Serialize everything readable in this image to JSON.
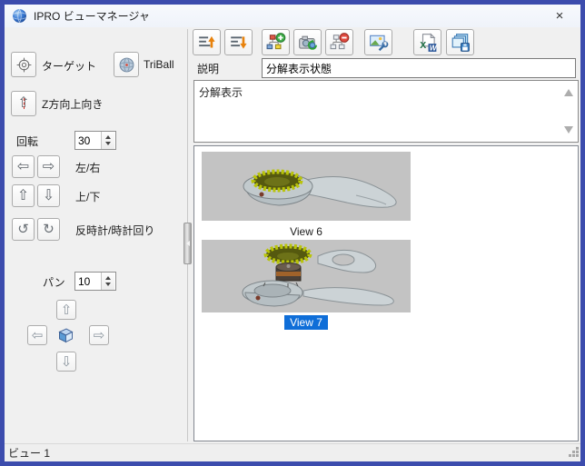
{
  "window": {
    "title": "IPRO ビューマネージャ",
    "close_glyph": "×"
  },
  "left_panel": {
    "target_label": "ターゲット",
    "triball_label": "TriBall",
    "z_up_label": "Z方向上向き",
    "rotation_label": "回転",
    "rotation_value": "30",
    "left_right_label": "左/右",
    "up_down_label": "上/下",
    "ccw_cw_label": "反時計/時計回り",
    "pan_label": "パン",
    "pan_value": "10"
  },
  "glyphs": {
    "arrow_left": "⇦",
    "arrow_right": "⇨",
    "arrow_up": "⇧",
    "arrow_down": "⇩",
    "rotate_ccw": "↺",
    "rotate_cw": "↻"
  },
  "toolbar": {
    "icons": [
      "move-view-up",
      "move-view-down",
      "add-view",
      "update-view",
      "delete-view",
      "view-settings",
      "export-office",
      "save-view-images"
    ]
  },
  "description": {
    "label": "説明",
    "value": "分解表示状態"
  },
  "comment": {
    "text": "分解表示"
  },
  "view_list": [
    {
      "label": "View 6",
      "selected": false
    },
    {
      "label": "View 7",
      "selected": true
    }
  ],
  "status_bar": {
    "text": "ビュー 1"
  },
  "colors": {
    "window_border": "#3c4cad",
    "selection_blue": "#0f6ed8",
    "thumbnail_bg": "#c3c3c3",
    "accent_orange": "#e8820c",
    "impeller_olive": "#8a901c"
  }
}
